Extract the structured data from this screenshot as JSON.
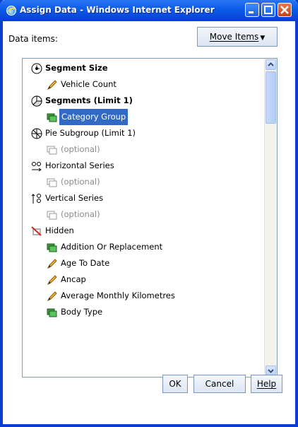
{
  "window": {
    "title": "Assign Data - Windows Internet Explorer"
  },
  "label": "Data items:",
  "move_items": "Move Items",
  "tree": [
    {
      "label": "Segment Size",
      "icon": "segment-size-icon"
    },
    {
      "label": "Vehicle Count",
      "icon": "pencil-icon"
    },
    {
      "label": "Segments (Limit 1)",
      "icon": "pie-chart-icon"
    },
    {
      "label": "Category Group",
      "icon": "group-icon"
    },
    {
      "label": "Pie Subgroup (Limit 1)",
      "icon": "pie-subgroup-icon"
    },
    {
      "label": "(optional)",
      "icon": "group-icon"
    },
    {
      "label": "Horizontal Series",
      "icon": "horizontal-series-icon"
    },
    {
      "label": "(optional)",
      "icon": "group-icon"
    },
    {
      "label": "Vertical Series",
      "icon": "vertical-series-icon"
    },
    {
      "label": "(optional)",
      "icon": "group-icon"
    },
    {
      "label": "Hidden",
      "icon": "hidden-icon"
    },
    {
      "label": "Addition Or Replacement",
      "icon": "group-icon"
    },
    {
      "label": "Age To Date",
      "icon": "pencil-icon"
    },
    {
      "label": "Ancap",
      "icon": "pencil-icon"
    },
    {
      "label": "Average Monthly Kilometres",
      "icon": "pencil-icon"
    },
    {
      "label": "Body Type",
      "icon": "group-icon"
    }
  ],
  "buttons": {
    "ok": "OK",
    "cancel": "Cancel",
    "help": "Help"
  }
}
